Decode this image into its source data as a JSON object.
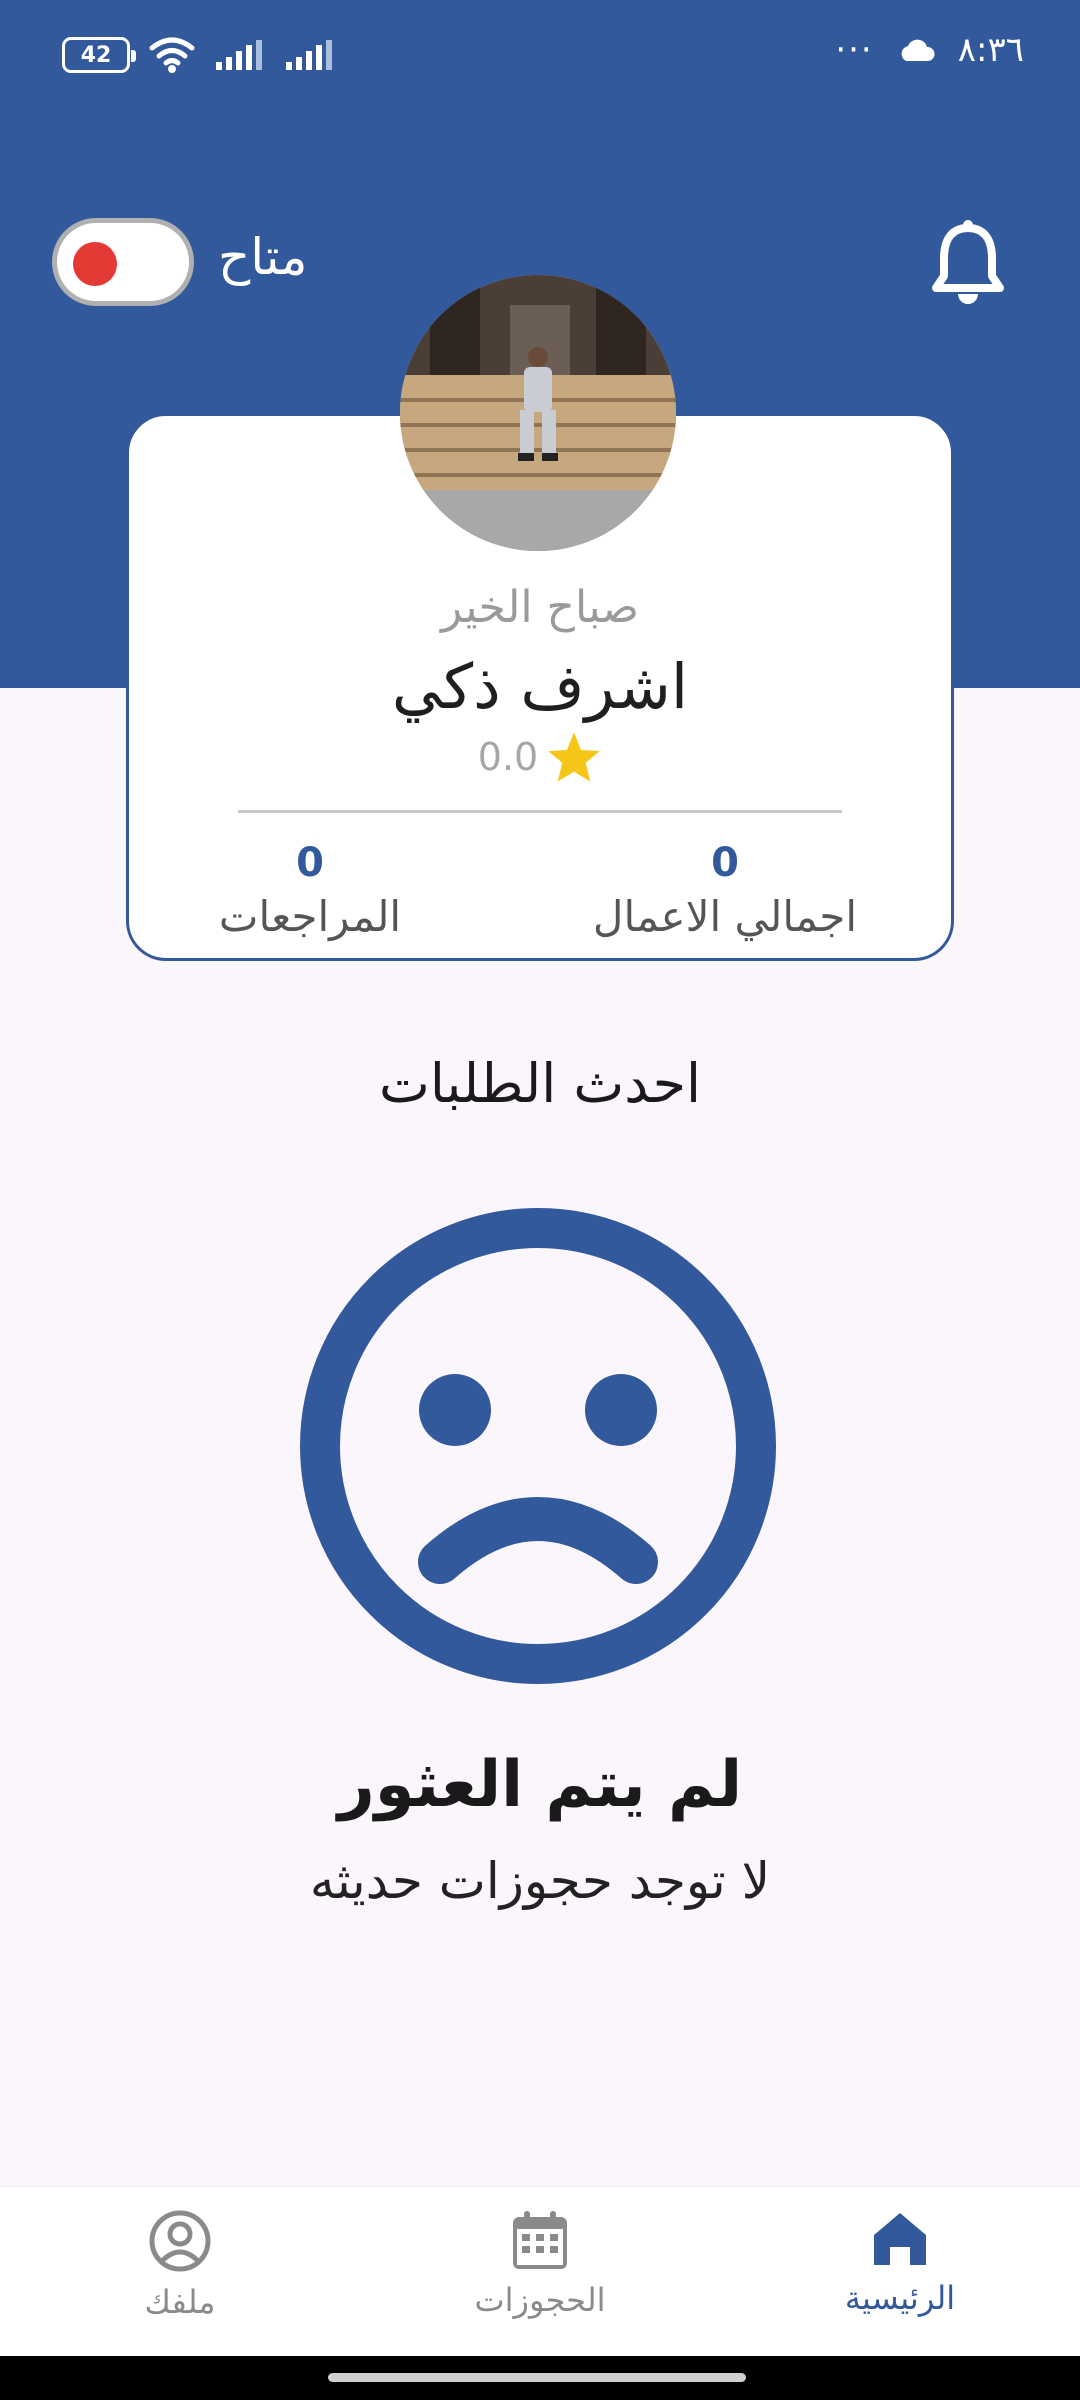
{
  "status_bar": {
    "time": "٨:٣٦",
    "battery": "42",
    "overflow": "···"
  },
  "header": {
    "availability_label": "متاح",
    "availability_on": false
  },
  "profile": {
    "greeting": "صباح الخير",
    "name": "اشرف ذكي",
    "rating": "0.0",
    "total_jobs_value": "0",
    "total_jobs_label": "اجمالي الاعمال",
    "reviews_value": "0",
    "reviews_label": "المراجعات"
  },
  "recent_requests": {
    "title": "احدث الطلبات",
    "empty_title": "لم يتم العثور",
    "empty_subtitle": "لا توجد حجوزات حديثه"
  },
  "nav": {
    "home": "الرئيسية",
    "bookings": "الحجوزات",
    "profile": "ملفك"
  },
  "colors": {
    "primary": "#32599b",
    "background": "#fbf5fc",
    "toggle_knob": "#e53935",
    "star": "#f5c518"
  },
  "icons": [
    "wifi-icon",
    "signal-icon",
    "cloud-icon",
    "bell-icon",
    "star-icon",
    "sad-face-icon",
    "home-icon",
    "calendar-icon",
    "user-circle-icon"
  ]
}
